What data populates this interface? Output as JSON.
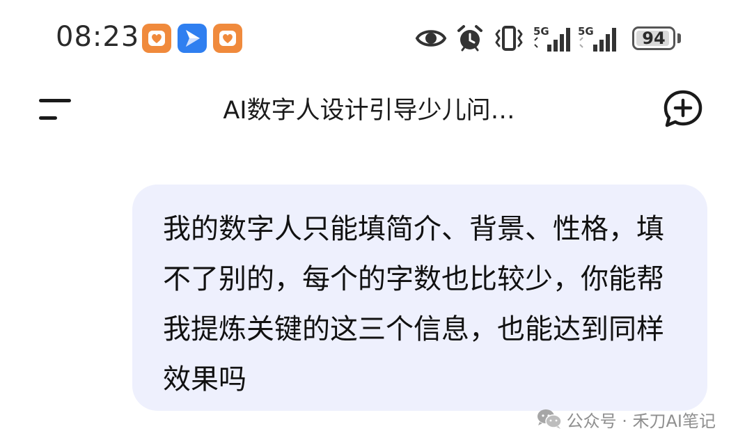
{
  "status_bar": {
    "time": "08:23",
    "app_icons": [
      "heart-app-icon",
      "paper-plane-app-icon",
      "heart-app-icon"
    ],
    "system_icons": [
      "eye-icon",
      "alarm-icon",
      "vibrate-icon",
      "signal-icon",
      "signal-icon"
    ],
    "signal_1_label": "5G",
    "signal_2_label": "5G",
    "battery_level": 94,
    "battery_text": "94"
  },
  "nav": {
    "title": "AI数字人设计引导少儿问…",
    "menu_icon": "menu-icon",
    "new_chat_icon": "new-chat-plus-icon"
  },
  "message": {
    "sender": "user",
    "text": "我的数字人只能填简介、背景、性格，填不了别的，每个的字数也比较少，你能帮我提炼关键的这三个信息，也能达到同样效果吗"
  },
  "watermark": {
    "icon": "wechat-icon",
    "text": "公众号 · 禾刀AI笔记"
  },
  "colors": {
    "bubble_bg": "#eef0fd",
    "app_orange": "#f08a3c",
    "app_blue": "#2f7ff0"
  }
}
